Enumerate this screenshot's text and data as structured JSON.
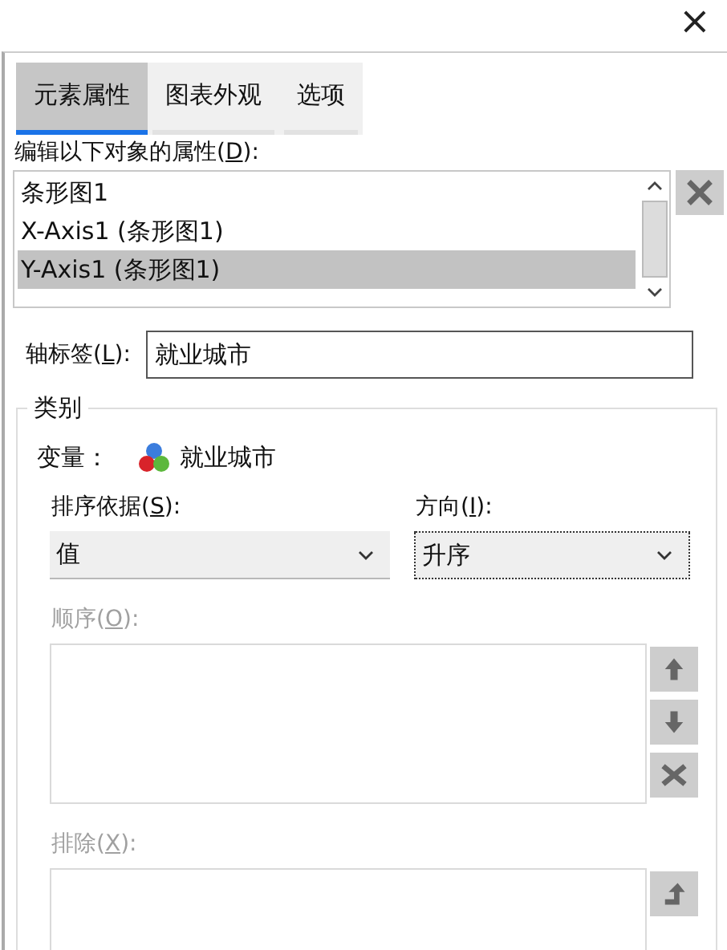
{
  "window": {
    "close": "×"
  },
  "tabs": [
    {
      "label": "元素属性",
      "selected": true
    },
    {
      "label": "图表外观",
      "selected": false
    },
    {
      "label": "选项",
      "selected": false
    }
  ],
  "objects": {
    "label_parts": [
      "编辑以下对象的属性(",
      "D",
      "):"
    ],
    "items": [
      {
        "label": "条形图1",
        "selected": false
      },
      {
        "label": "X-Axis1 (条形图1)",
        "selected": false
      },
      {
        "label": "Y-Axis1 (条形图1)",
        "selected": true
      }
    ]
  },
  "axis_label": {
    "label_parts": [
      "轴标签(",
      "L",
      "):"
    ],
    "value": "就业城市"
  },
  "category": {
    "title": "类别",
    "variable_label": "变量：",
    "variable": "就业城市",
    "sort_by": {
      "label_parts": [
        "排序依据(",
        "S",
        "):"
      ],
      "value": "值"
    },
    "direction": {
      "label_parts": [
        "方向(",
        "I",
        "):"
      ],
      "value": "升序"
    },
    "order": {
      "label_parts": [
        "顺序(",
        "O",
        "):"
      ],
      "disabled": true
    },
    "exclude": {
      "label_parts": [
        "排除(",
        "X",
        "):"
      ],
      "disabled": true
    }
  }
}
